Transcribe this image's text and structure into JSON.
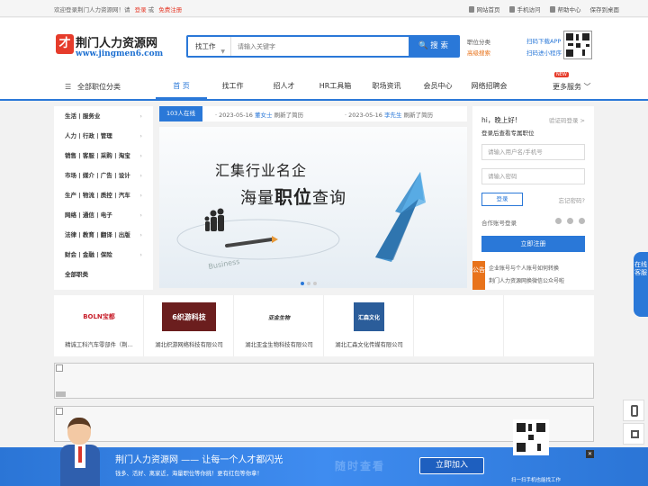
{
  "topbar": {
    "welcome": "欢迎登录荆门人力资源网！请",
    "login": "登录",
    "or": "或",
    "register": "免费注册",
    "links": [
      "网站首页",
      "手机访问",
      "帮助中心",
      "保存到桌面"
    ]
  },
  "logo": {
    "mark": "才",
    "name": "荆门人力资源网",
    "url": "www.jingmen6.com"
  },
  "search": {
    "type": "找工作",
    "placeholder": "请输入关键字",
    "button": "搜 索"
  },
  "header_links": {
    "category": "职位分类",
    "map": "高级搜索",
    "app": "扫码下载APP",
    "mini": "扫码进小程序"
  },
  "nav": {
    "all_categories": "全部职位分类",
    "items": [
      "首 页",
      "找工作",
      "招人才",
      "HR工具箱",
      "职场资讯",
      "会员中心",
      "网络招聘会"
    ],
    "more": "更多服务",
    "new_badge": "NEW"
  },
  "side_categories": [
    "生活 | 服务业",
    "人力 | 行政 | 管理",
    "销售 | 客服 | 采购 | 淘宝",
    "市场 | 媒介 | 广告 | 设计",
    "生产 | 物流 | 质控 | 汽车",
    "网络 | 通信 | 电子",
    "法律 | 教育 | 翻译 | 出版",
    "财会 | 金融 | 保险",
    "全部职类"
  ],
  "ticker": {
    "online": "103人在线",
    "items": [
      {
        "date": "2023-05-16",
        "name": "董女士",
        "action": "刷新了简历"
      },
      {
        "date": "2023-05-16",
        "name": "李先生",
        "action": "刷新了简历"
      }
    ]
  },
  "banner": {
    "line1": "汇集行业名企",
    "line2a": "海量",
    "line2b": "职位",
    "line2c": "查询"
  },
  "login": {
    "greeting": "hi，晚上好!",
    "code_login": "验证码登录 >",
    "subtitle": "登录后查看专属职位",
    "user_placeholder": "请输入用户名/手机号",
    "pass_placeholder": "请输入密码",
    "login_button": "登录",
    "forgot": "忘记密码?",
    "other": "合作账号登录",
    "register_button": "立即注册"
  },
  "notice": {
    "tag": "公告",
    "items": [
      "企业账号与个人账号如何转换",
      "荆门人力资源网换微信公众号啦"
    ]
  },
  "companies": [
    {
      "logo": "BOLN宝都",
      "name": "精诚工科汽车零部件（荆…"
    },
    {
      "logo": "6织游科技",
      "name": "湖北织游网络科技有限公司"
    },
    {
      "logo": "亚金生物",
      "name": "湖北亚金生物科技有限公司"
    },
    {
      "logo": "汇森文化",
      "name": "湖北汇森文化传媒有限公司"
    }
  ],
  "footer": {
    "title": "荆门人力资源网 —— 让每一个人才都闪光",
    "subtitle": "钱多、活好、离家近，海量职位等你挑！更有红包等你拿！",
    "watermark": "随时查看",
    "join": "立即加入",
    "scan": "扫一扫手机也能找工作",
    "close": "✕"
  },
  "side_service": "在线客服",
  "colors": {
    "accent": "#2a78d8",
    "brand_red": "#e63c2b",
    "orange": "#e8731b"
  }
}
